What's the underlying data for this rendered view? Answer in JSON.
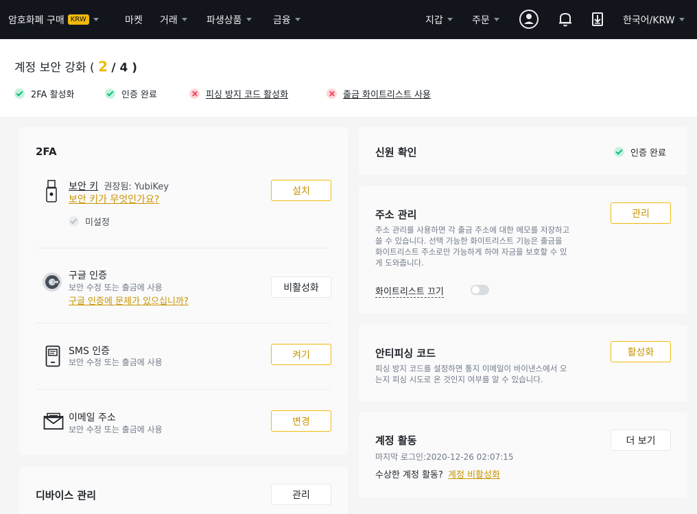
{
  "nav": {
    "buy_crypto": "암호화폐 구매",
    "buy_badge": "KRW",
    "market": "마켓",
    "trade": "거래",
    "derivatives": "파생상품",
    "finance": "금융",
    "wallet": "지갑",
    "orders": "주문",
    "language": "한국어/KRW",
    "icons": [
      "user-circle-icon",
      "bell-icon",
      "download-icon"
    ]
  },
  "header": {
    "title": "계정 보안 강화 (",
    "progress_current": "2",
    "progress_total": "/ 4 )",
    "statuses": [
      {
        "label": "2FA 활성화",
        "state": "ok"
      },
      {
        "label": "인증 완료",
        "state": "ok"
      },
      {
        "label": "피싱 방지 코드 활성화",
        "state": "missing"
      },
      {
        "label": "출금 화이트리스트 사용",
        "state": "missing"
      }
    ]
  },
  "twofa": {
    "title": "2FA",
    "security_key": {
      "title": "보안 키",
      "recommend": "권장됨: YubiKey",
      "link": "보안 키가 무엇인가요?",
      "status": "미설정",
      "button": "설치"
    },
    "google": {
      "title": "구글 인증",
      "sub": "보안 수정 또는 출금에 사용",
      "link": "구글 인증에 문제가 있으십니까?",
      "button": "비활성화"
    },
    "sms": {
      "title": "SMS 인증",
      "sub": "보안 수정 또는 출금에 사용",
      "button": "켜기"
    },
    "email": {
      "title": "이메일 주소",
      "sub": "보안 수정 또는 출금에 사용",
      "button": "변경"
    }
  },
  "device": {
    "title": "디바이스 관리",
    "button": "관리"
  },
  "identity": {
    "title": "신원 확인",
    "status": "인증 완료"
  },
  "address": {
    "title": "주소 관리",
    "desc_lines": [
      "주소 관리를 사용하면 각 출금 주소에 대한 메모를 저장하고",
      "쓸 수 있습니다. 선택 가능한 화이트리스트 기능은 출금을",
      "화이트리스트 주소로만 가능하게 하여 자금을 보호할 수 있",
      "게 도와줍니다."
    ],
    "button": "관리",
    "whitelist_label": "화이트리스트 끄기",
    "whitelist_on": false
  },
  "antiphishing": {
    "title": "안티피싱 코드",
    "desc_lines": [
      "피싱 방지 코드를 설정하면 통지 이메일이 바이낸스에서 오",
      "는지 피싱 시도로 온 것인지 여부를 알 수 있습니다."
    ],
    "button": "활성화"
  },
  "activity": {
    "title": "계정 활동",
    "last_login": "마지막 로그인:2020-12-26 02:07:15",
    "suspicious": "수상한 계정 활동?",
    "disable_link": "계정 비활성화",
    "button": "더 보기"
  },
  "colors": {
    "accent": "#f0b90b",
    "nav_bg": "#12161c",
    "success": "#02c076",
    "danger": "#f6465d"
  }
}
